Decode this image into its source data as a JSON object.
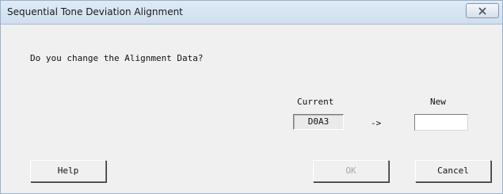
{
  "window": {
    "title": "Sequential Tone Deviation Alignment"
  },
  "dialog": {
    "question": "Do you change the Alignment Data?",
    "current_label": "Current",
    "new_label": "New",
    "current_value": "D0A3",
    "arrow": "->",
    "new_value": ""
  },
  "buttons": {
    "help": "Help",
    "ok": "OK",
    "cancel": "Cancel"
  },
  "icons": {
    "close": "close-icon"
  },
  "colors": {
    "titlebar": "#cfdff0",
    "window_bg": "#f0f0f0",
    "disabled_text": "#a8a8a8"
  }
}
